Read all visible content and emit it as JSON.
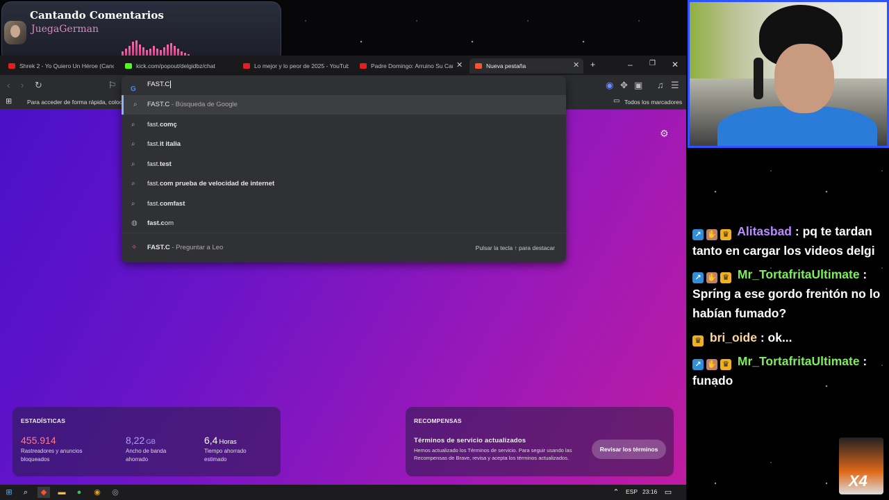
{
  "now_playing": {
    "title": "Cantando Comentarios",
    "artist": "JuegaGerman",
    "bar_levels": [
      10,
      14,
      18,
      24,
      26,
      20,
      16,
      12,
      14,
      18,
      14,
      12,
      16,
      20,
      22,
      18,
      14,
      10,
      8,
      6
    ]
  },
  "browser": {
    "tabs": [
      {
        "label": "Shrek 2 - Yo Quiero Un Héroe (Canc",
        "icon": "youtube-icon",
        "color": "#e02020"
      },
      {
        "label": "kick.com/popout/delgidbz/chat",
        "icon": "kick-icon",
        "color": "#53fc18"
      },
      {
        "label": "Lo mejor y lo peor de 2025 - YouTub",
        "icon": "youtube-icon",
        "color": "#e02020"
      },
      {
        "label": "Padre Domingo: Arruino Su Carr",
        "icon": "youtube-icon",
        "color": "#e02020"
      },
      {
        "label": "Nueva pestaña",
        "icon": "brave-icon",
        "color": "#fb542b"
      }
    ],
    "new_tab_symbol": "+",
    "window_controls": {
      "minimize": "–",
      "restore": "❐",
      "close": "✕"
    },
    "address_value": "FAST.C",
    "bookmarks_hint": "Para acceder de forma rápida, coloca",
    "bookmarks_all": "Todos los marcadores",
    "suggestions": [
      {
        "bold": "",
        "plain": "FAST.C",
        "suffix": " - Búsqueda de Google",
        "icon": "search-icon",
        "selected": true
      },
      {
        "plain": "fast.",
        "bold": "comç",
        "suffix": "",
        "icon": "search-icon"
      },
      {
        "plain": "fast.",
        "bold": "it italia",
        "suffix": "",
        "icon": "search-icon"
      },
      {
        "plain": "fast.",
        "bold": "test",
        "suffix": "",
        "icon": "search-icon"
      },
      {
        "plain": "fast.",
        "bold": "com prueba de velocidad de internet",
        "suffix": "",
        "icon": "search-icon"
      },
      {
        "plain": "fast.",
        "bold": "comfast",
        "suffix": "",
        "icon": "search-icon"
      },
      {
        "plain": "fast.c",
        "bold": "om",
        "suffix": "",
        "icon": "globe-icon"
      }
    ],
    "leo": {
      "query": "FAST.C",
      "suffix": " - Preguntar a Leo",
      "hint": "Pulsar la tecla ↑ para destacar"
    },
    "stats": {
      "heading": "ESTADÍSTICAS",
      "items": [
        {
          "value": "455.914",
          "unit": "",
          "label": "Rastreadores y anuncios bloqueados",
          "color": "#ff7a8a"
        },
        {
          "value": "8,22",
          "unit": "GB",
          "label": "Ancho de banda ahorrado",
          "color": "#b59cff"
        },
        {
          "value": "6,4",
          "unit": "Horas",
          "label": "Tiempo ahorrado estimado",
          "color": "#ffffff"
        }
      ]
    },
    "rewards": {
      "heading": "RECOMPENSAS",
      "title": "Términos de servicio actualizados",
      "body": "Hemos actualizado los Términos de servicio. Para seguir usando las Recompensas de Brave, revisa y acepta los términos actualizados.",
      "button": "Revisar los términos"
    }
  },
  "taskbar": {
    "lang": "ESP",
    "time": "23:16"
  },
  "chat": [
    {
      "user": "Alitasbad",
      "color": "#b98cff",
      "text": "pq te tardan tanto en cargar los videos delgi",
      "badges": [
        "blue",
        "hand",
        "crown"
      ]
    },
    {
      "user": "Mr_TortafritaUltimate",
      "color": "#7cf05a",
      "text": "Spring a ese gordo frentón no lo habían fumado?",
      "badges": [
        "blue",
        "hand",
        "crown"
      ]
    },
    {
      "user": "bri_oide",
      "color": "#ffd8a0",
      "text": "ok...",
      "badges": [
        "crown"
      ]
    },
    {
      "user": "Mr_TortafritaUltimate",
      "color": "#7cf05a",
      "text": "funado",
      "badges": [
        "blue",
        "hand",
        "crown"
      ]
    }
  ],
  "overlay_badge": "X4"
}
